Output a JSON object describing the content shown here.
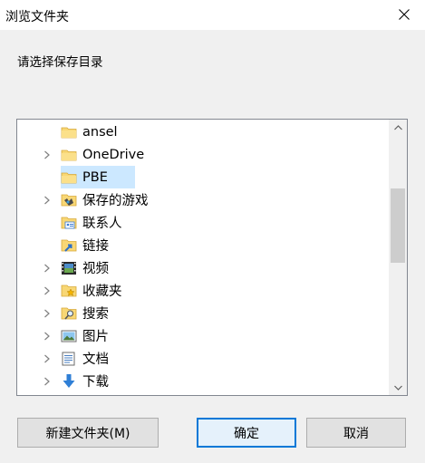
{
  "window": {
    "title": "浏览文件夹"
  },
  "prompt": "请选择保存目录",
  "tree": {
    "items": [
      {
        "label": "ansel",
        "icon": "folder-icon",
        "has_children": false,
        "selected": false
      },
      {
        "label": "OneDrive",
        "icon": "folder-icon",
        "has_children": true,
        "selected": false
      },
      {
        "label": "PBE",
        "icon": "folder-icon",
        "has_children": false,
        "selected": true
      },
      {
        "label": "保存的游戏",
        "icon": "saved-games-icon",
        "has_children": true,
        "selected": false
      },
      {
        "label": "联系人",
        "icon": "contacts-icon",
        "has_children": false,
        "selected": false
      },
      {
        "label": "链接",
        "icon": "links-icon",
        "has_children": false,
        "selected": false
      },
      {
        "label": "视频",
        "icon": "videos-icon",
        "has_children": true,
        "selected": false
      },
      {
        "label": "收藏夹",
        "icon": "favorites-icon",
        "has_children": true,
        "selected": false
      },
      {
        "label": "搜索",
        "icon": "searches-icon",
        "has_children": true,
        "selected": false
      },
      {
        "label": "图片",
        "icon": "pictures-icon",
        "has_children": true,
        "selected": false
      },
      {
        "label": "文档",
        "icon": "documents-icon",
        "has_children": true,
        "selected": false
      },
      {
        "label": "下载",
        "icon": "downloads-icon",
        "has_children": true,
        "selected": false
      }
    ]
  },
  "buttons": {
    "new_folder": "新建文件夹(M)",
    "ok": "确定",
    "cancel": "取消"
  },
  "colors": {
    "selection": "#cce8ff",
    "folder": "#f8d775",
    "accent": "#0078d7"
  }
}
